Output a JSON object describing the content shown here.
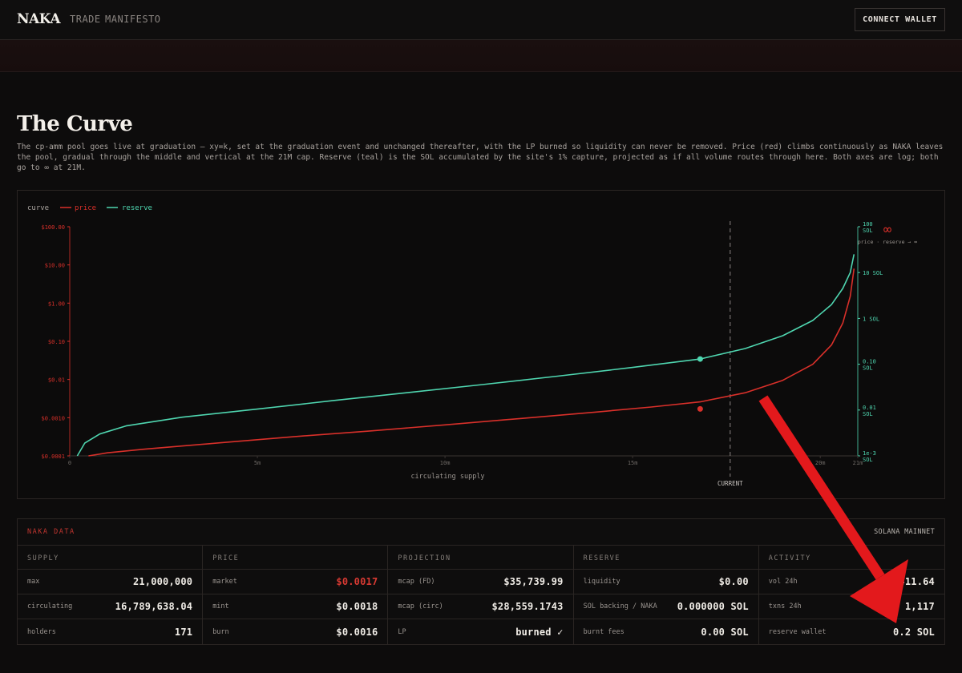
{
  "header": {
    "logo": "NAKA",
    "nav": [
      "TRADE",
      "MANIFESTO"
    ],
    "connect_label": "CONNECT WALLET"
  },
  "page": {
    "title": "The Curve",
    "description": "The cp-amm pool goes live at graduation — xy=k, set at the graduation event and unchanged thereafter, with the LP burned so liquidity can never be removed. Price (red) climbs continuously as NAKA leaves the pool, gradual through the middle and vertical at the 21M cap. Reserve (teal) is the SOL accumulated by the site's 1% capture, projected as if all volume routes through here. Both axes are log; both go to ∞ at 21M."
  },
  "colors": {
    "price": "#d9302a",
    "reserve": "#4fd6b0",
    "accent_red": "#d93a33"
  },
  "chart_data": {
    "type": "line",
    "legend": {
      "title": "curve",
      "entries": [
        "price",
        "reserve"
      ],
      "placement": "top-left"
    },
    "xlabel": "circulating supply",
    "x_ticks": [
      "0",
      "5m",
      "10m",
      "15m",
      "20m",
      "21m"
    ],
    "x_tick_values": [
      0,
      5,
      10,
      15,
      20,
      21
    ],
    "xlim": [
      0,
      21
    ],
    "y_left_ticks": [
      "$100.00",
      "$10.00",
      "$1.00",
      "$0.10",
      "$0.01",
      "$0.0010",
      "$0.0001"
    ],
    "y_left_values": [
      100,
      10,
      1,
      0.1,
      0.01,
      0.001,
      0.0001
    ],
    "y_left_scale": "log",
    "y_right_ticks": [
      "100 SOL",
      "10 SOL",
      "1 SOL",
      "0.10 SOL",
      "0.01 SOL",
      "1e-3 SOL"
    ],
    "y_right_values": [
      100,
      10,
      1,
      0.1,
      0.01,
      0.001
    ],
    "y_right_scale": "log",
    "current_label": "CURRENT",
    "current_supply": 17.6,
    "infinity_label": "∞",
    "infinity_note": "price · reserve → ∞",
    "series": [
      {
        "name": "price",
        "x": [
          0.5,
          1,
          2,
          4,
          6,
          8,
          10,
          12,
          14,
          15.5,
          16.8,
          18,
          19,
          19.8,
          20.3,
          20.6,
          20.8,
          20.9
        ],
        "y": [
          0.0001,
          0.00012,
          0.00015,
          0.00022,
          0.00032,
          0.00045,
          0.00065,
          0.00095,
          0.0014,
          0.0019,
          0.0026,
          0.0045,
          0.0095,
          0.025,
          0.08,
          0.3,
          1.5,
          8
        ],
        "marker": {
          "x": 16.8,
          "y": 0.0017
        }
      },
      {
        "name": "reserve",
        "x": [
          0.2,
          0.4,
          0.8,
          1.5,
          3,
          5,
          7,
          9,
          11,
          13,
          15,
          16.8,
          18,
          19,
          19.8,
          20.3,
          20.6,
          20.8,
          20.9
        ],
        "y": [
          0.001,
          0.0019,
          0.003,
          0.0045,
          0.007,
          0.0105,
          0.016,
          0.024,
          0.036,
          0.055,
          0.085,
          0.13,
          0.22,
          0.42,
          0.9,
          2.0,
          4.5,
          10,
          25
        ],
        "marker": {
          "x": 16.8,
          "y": 0.13
        }
      }
    ]
  },
  "data_panel": {
    "title": "NAKA DATA",
    "network": "SOLANA MAINNET",
    "columns": [
      {
        "heading": "SUPPLY",
        "rows": [
          {
            "label": "max",
            "value": "21,000,000"
          },
          {
            "label": "circulating",
            "value": "16,789,638.04"
          },
          {
            "label": "holders",
            "value": "171"
          }
        ]
      },
      {
        "heading": "PRICE",
        "rows": [
          {
            "label": "market",
            "value": "$0.0017",
            "red": true
          },
          {
            "label": "mint",
            "value": "$0.0018"
          },
          {
            "label": "burn",
            "value": "$0.0016"
          }
        ]
      },
      {
        "heading": "PROJECTION",
        "rows": [
          {
            "label": "mcap (FD)",
            "value": "$35,739.99"
          },
          {
            "label": "mcap (circ)",
            "value": "$28,559.1743"
          },
          {
            "label": "LP",
            "value": "burned ✓"
          }
        ]
      },
      {
        "heading": "RESERVE",
        "rows": [
          {
            "label": "liquidity",
            "value": "$0.00"
          },
          {
            "label": "SOL backing / NAKA",
            "value": "0.000000 SOL"
          },
          {
            "label": "burnt fees",
            "value": "0.00 SOL"
          }
        ]
      },
      {
        "heading": "ACTIVITY",
        "rows": [
          {
            "label": "vol 24h",
            "value": "$6,411.64"
          },
          {
            "label": "txns 24h",
            "value": "1,117"
          },
          {
            "label": "reserve wallet",
            "value": "0.2 SOL"
          }
        ]
      }
    ]
  }
}
